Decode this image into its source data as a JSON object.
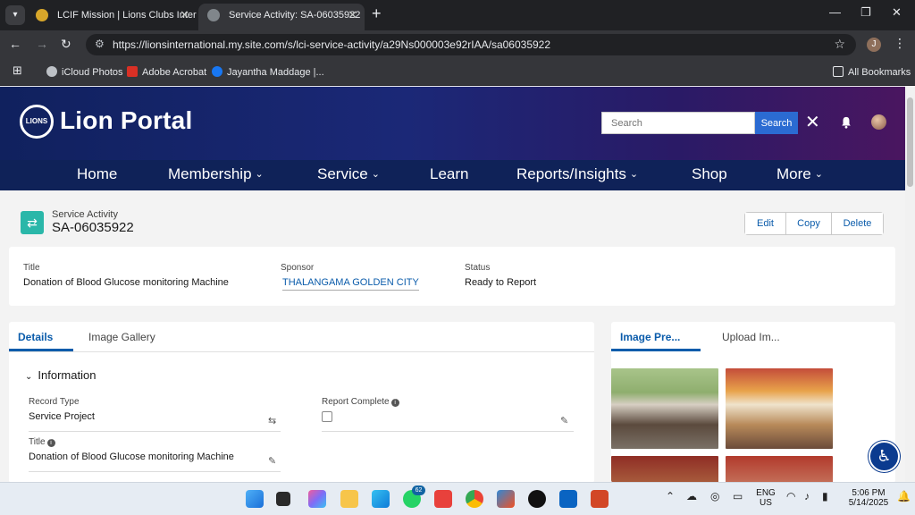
{
  "browser": {
    "tabs": [
      {
        "title": "LCIF Mission | Lions Clubs Intern"
      },
      {
        "title": "Service Activity: SA-06035922"
      }
    ],
    "url": "https://lionsinternational.my.site.com/s/lci-service-activity/a29Ns000003e92rIAA/sa06035922",
    "profile_initial": "J",
    "bookmarks": [
      "iCloud Photos",
      "Adobe Acrobat",
      "Jayantha Maddage |..."
    ],
    "all_bookmarks": "All Bookmarks"
  },
  "portal": {
    "logo_text": "Lion Portal",
    "logo_badge": "LIONS",
    "search_placeholder": "Search",
    "search_button": "Search",
    "nav": [
      "Home",
      "Membership",
      "Service",
      "Learn",
      "Reports/Insights",
      "Shop",
      "More"
    ]
  },
  "record": {
    "type_label": "Service Activity",
    "name": "SA-06035922",
    "actions": [
      "Edit",
      "Copy",
      "Delete"
    ]
  },
  "highlights": {
    "title_label": "Title",
    "title_value": "Donation of Blood Glucose monitoring Machine",
    "sponsor_label": "Sponsor",
    "sponsor_value": "THALANGAMA GOLDEN CITY",
    "status_label": "Status",
    "status_value": "Ready to Report"
  },
  "details": {
    "tabs": [
      "Details",
      "Image Gallery"
    ],
    "section_title": "Information",
    "record_type_label": "Record Type",
    "record_type_value": "Service Project",
    "report_complete_label": "Report Complete",
    "title_label": "Title",
    "title_value": "Donation of Blood Glucose monitoring Machine"
  },
  "images": {
    "tabs": [
      "Image Pre...",
      "Upload Im..."
    ]
  },
  "taskbar": {
    "whatsapp_badge": "62",
    "lang_line1": "ENG",
    "lang_line2": "US",
    "time": "5:06 PM",
    "date": "5/14/2025"
  },
  "colors": {
    "accent": "#0b5cab",
    "nav_bg": "#0f2258",
    "record_icon": "#2ab7a9",
    "search_button": "#2b6bd2"
  }
}
